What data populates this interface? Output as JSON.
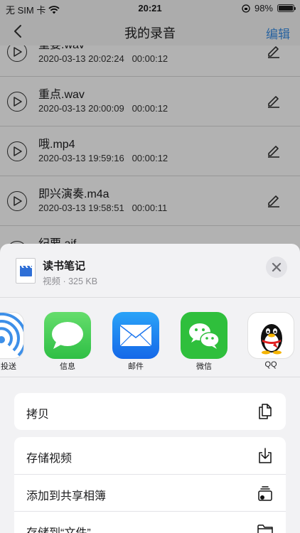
{
  "status_bar": {
    "carrier": "无 SIM 卡",
    "time": "20:21",
    "battery": "98%",
    "battery_level": 0.98
  },
  "nav": {
    "back_icon": "chevron-left-icon",
    "title": "我的录音",
    "edit_label": "编辑"
  },
  "recordings": [
    {
      "name": "重要.wav",
      "date": "2020-03-13 20:02:24",
      "duration": "00:00:12"
    },
    {
      "name": "重点.wav",
      "date": "2020-03-13 20:00:09",
      "duration": "00:00:12"
    },
    {
      "name": "哦.mp4",
      "date": "2020-03-13 19:59:16",
      "duration": "00:00:12"
    },
    {
      "name": "即兴演奏.m4a",
      "date": "2020-03-13 19:58:51",
      "duration": "00:00:11"
    },
    {
      "name": "纪要.aif",
      "date": "",
      "duration": ""
    }
  ],
  "share_sheet": {
    "file_name": "读书笔记",
    "file_info": "视频 · 325 KB",
    "apps": [
      {
        "label": "投送",
        "icon": "airdrop-icon",
        "color": "#3d8fe8"
      },
      {
        "label": "信息",
        "icon": "messages-icon",
        "color": "#34c759"
      },
      {
        "label": "邮件",
        "icon": "mail-icon",
        "color": "#1e7cf2"
      },
      {
        "label": "微信",
        "icon": "wechat-icon",
        "color": "#2fbf3c"
      },
      {
        "label": "QQ",
        "icon": "qq-penguin-icon",
        "color": "#111111"
      }
    ],
    "actions": [
      {
        "label": "拷贝",
        "icon": "copy-icon"
      },
      {
        "label": "存储视频",
        "icon": "save-download-icon"
      },
      {
        "label": "添加到共享相簿",
        "icon": "shared-album-icon"
      },
      {
        "label": "存储到“文件”",
        "icon": "folder-icon"
      }
    ]
  }
}
